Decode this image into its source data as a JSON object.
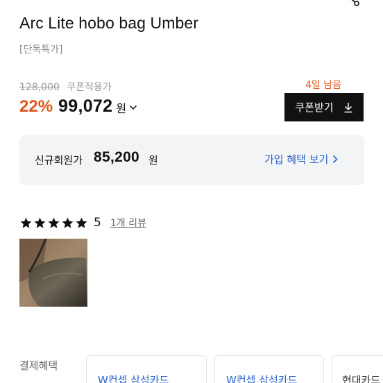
{
  "product": {
    "title": "Arc Lite hobo bag Umber",
    "tag": "[단독특가]"
  },
  "pricing": {
    "original_price": "128,000",
    "coupon_label": "쿠폰적용가",
    "days_left": "4일 남음",
    "discount": "22%",
    "sale_price": "99,072",
    "currency": "원",
    "coupon_button_label": "쿠폰받기"
  },
  "member_offer": {
    "label": "신규회원가",
    "price": "85,200",
    "currency": "원",
    "link_label": "가입 혜택 보기"
  },
  "reviews": {
    "stars": 5,
    "rating": "5",
    "count_label": "1개 리뷰"
  },
  "payment": {
    "label": "결제혜택",
    "cards": [
      "W컨셉 삼성카드",
      "W컨셉 삼성카드",
      "현대카드"
    ]
  },
  "colors": {
    "accent_orange": "#e0561a",
    "link_blue": "#2a63c9",
    "button_black": "#111111",
    "panel_gray": "#f3f4f6"
  },
  "icons": [
    "share-icon",
    "chevron-down-icon",
    "download-icon",
    "chevron-right-icon",
    "star-icon"
  ]
}
